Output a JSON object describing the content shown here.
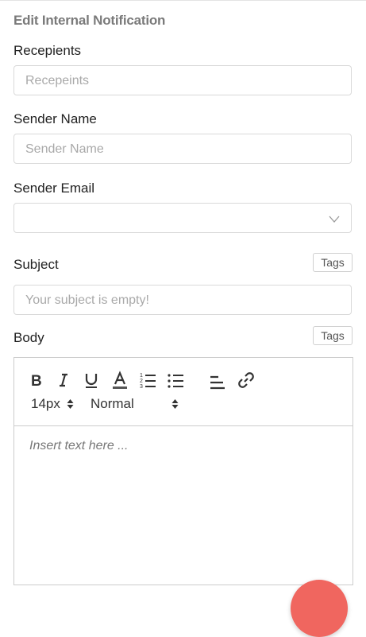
{
  "header": {
    "title": "Edit Internal Notification"
  },
  "form": {
    "recipients": {
      "label": "Recepients",
      "placeholder": "Recepeints"
    },
    "sender_name": {
      "label": "Sender Name",
      "placeholder": "Sender Name"
    },
    "sender_email": {
      "label": "Sender Email",
      "value": ""
    },
    "subject": {
      "label": "Subject",
      "tags_label": "Tags",
      "placeholder": "Your subject is empty!"
    },
    "body": {
      "label": "Body",
      "tags_label": "Tags",
      "font_size": "14px",
      "block_format": "Normal",
      "placeholder": "Insert text here ..."
    }
  },
  "toolbar": {
    "icons": [
      "bold-icon",
      "italic-icon",
      "underline-icon",
      "font-color-icon",
      "ordered-list-icon",
      "bullet-list-icon",
      "align-icon",
      "link-icon"
    ]
  },
  "colors": {
    "fab": "#f0665f",
    "border": "#d9d9d9",
    "title": "#7a7a7a"
  }
}
